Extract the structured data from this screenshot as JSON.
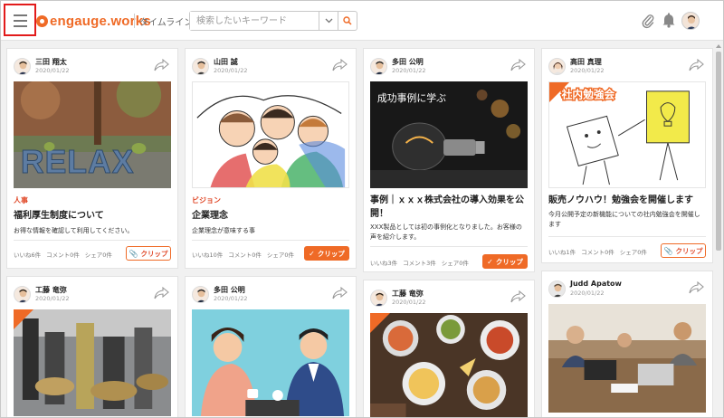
{
  "header": {
    "logo_text": "engauge.works",
    "nav_label": "タイムライン",
    "search_placeholder": "検索したいキーワード",
    "select_icon": "chevron-down-icon",
    "search_icon": "search-icon",
    "clip_icon": "paperclip-icon",
    "bell_icon": "bell-icon",
    "accent": "#ef6a26"
  },
  "cards": [
    {
      "author": "三田 翔太",
      "date": "2020/01/22",
      "image": "relax-letters-photo",
      "category": "人事",
      "title": "福利厚生制度について",
      "description": "お得な情報を確認して利用してください。",
      "likes": "いいね6件",
      "comments": "コメント0件",
      "shares": "シェア0件",
      "clip_label": "クリップ",
      "clipped": false
    },
    {
      "author": "山田 誠",
      "date": "2020/01/22",
      "image": "family-drawing-illustration",
      "category": "ビジョン",
      "title": "企業理念",
      "description": "企業理念が意味する事",
      "likes": "いいね10件",
      "comments": "コメント0件",
      "shares": "シェア0件",
      "clip_label": "クリップ",
      "clipped": true
    },
    {
      "author": "多田 公明",
      "date": "2020/01/22",
      "image": "lightbulb-photo",
      "image_caption": "成功事例に学ぶ",
      "title": "事例｜ｘｘｘ株式会社の導入効果を公開！",
      "description": "XXX製品としては初の事例化となりました。お客様の声を紹介します。",
      "likes": "いいね3件",
      "comments": "コメント3件",
      "shares": "シェア0件",
      "clip_label": "クリップ",
      "clipped": true
    },
    {
      "author": "高田 真理",
      "date": "2020/01/22",
      "image": "study-session-illustration",
      "image_caption": "社内勉強会",
      "title": "販売ノウハウ！勉強会を開催します",
      "description": "今月公開予定の新機能についての社内勉強会を開催します",
      "likes": "いいね1件",
      "comments": "コメント0件",
      "shares": "シェア0件",
      "clip_label": "クリップ",
      "clipped": false
    },
    {
      "author": "工藤 竜弥",
      "date": "2020/01/22",
      "image": "machine-tools-photo"
    },
    {
      "author": "多田 公明",
      "date": "2020/01/22",
      "image": "meeting-illustration"
    },
    {
      "author": "工藤 竜弥",
      "date": "2020/01/22",
      "image": "food-table-photo"
    },
    {
      "author": "Judd Apatow",
      "date": "2020/01/22",
      "image": "office-laptops-photo"
    }
  ]
}
